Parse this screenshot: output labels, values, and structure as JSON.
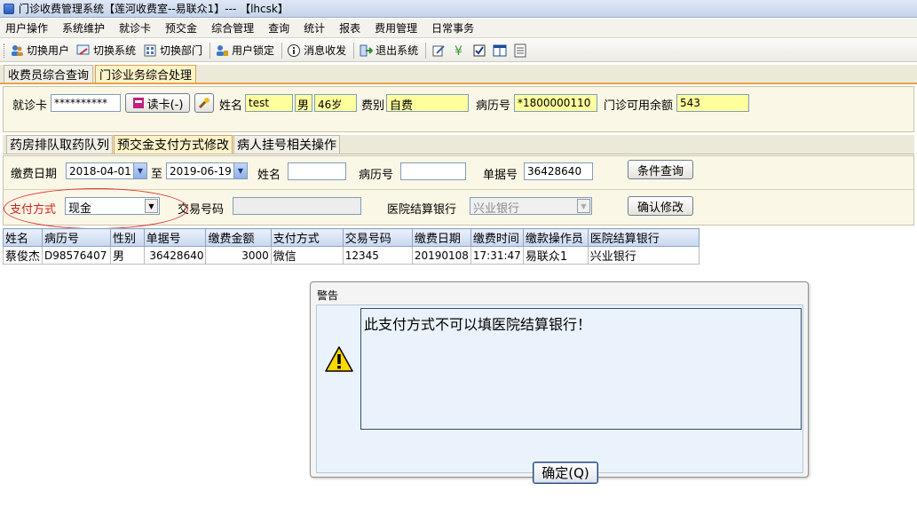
{
  "window": {
    "title": "门诊收费管理系统【莲河收费室--易联众1】--- 【lhcsk】"
  },
  "menu": [
    "用户操作",
    "系统维护",
    "就诊卡",
    "预交金",
    "综合管理",
    "查询",
    "统计",
    "报表",
    "费用管理",
    "日常事务"
  ],
  "toolbar": {
    "switch_user": "切换用户",
    "switch_system": "切换系统",
    "switch_dept": "切换部门",
    "user_lock": "用户锁定",
    "message": "消息收发",
    "exit": "退出系统"
  },
  "main_tabs": [
    "收费员综合查询",
    "门诊业务综合处理"
  ],
  "patient": {
    "card_label": "就诊卡",
    "card_value": "**********",
    "read_card": "读卡(-)",
    "name_label": "姓名",
    "name_value": "test",
    "gender": "男",
    "age": "46岁",
    "category_label": "费别",
    "category_value": "自费",
    "record_label": "病历号",
    "record_value": "*1800000110",
    "balance_label": "门诊可用余额",
    "balance_value": "543"
  },
  "sub_tabs": [
    "药房排队取药队列",
    "预交金支付方式修改",
    "病人挂号相关操作"
  ],
  "query": {
    "date_label": "缴费日期",
    "date_from": "2018-04-01",
    "to_label": "至",
    "date_to": "2019-06-19",
    "name_label": "姓名",
    "name_value": "",
    "record_label": "病历号",
    "record_value": "",
    "receipt_label": "单据号",
    "receipt_value": "36428640",
    "search_button": "条件查询",
    "payment_label": "支付方式",
    "payment_value": "现金",
    "txn_label": "交易号码",
    "txn_value": "",
    "bank_label": "医院结算银行",
    "bank_value": "兴业银行",
    "confirm_button": "确认修改"
  },
  "grid": {
    "columns": [
      "姓名",
      "病历号",
      "性别",
      "单据号",
      "缴费金额",
      "支付方式",
      "交易号码",
      "缴费日期",
      "缴费时间",
      "缴款操作员",
      "医院结算银行"
    ],
    "rows": [
      [
        "蔡俊杰",
        "D98576407",
        "男",
        "36428640",
        "3000",
        "微信",
        "12345",
        "20190108",
        "17:31:47",
        "易联众1",
        "兴业银行"
      ]
    ]
  },
  "dialog": {
    "title": "警告",
    "message": "此支付方式不可以填医院结算银行！",
    "ok_button": "确定(Q)"
  },
  "colors": {
    "panel_bg": "#fbf7e6",
    "highlight_field": "#ffff9e",
    "active_tab": "#fdf3c8",
    "annotation_red": "#e03030"
  }
}
